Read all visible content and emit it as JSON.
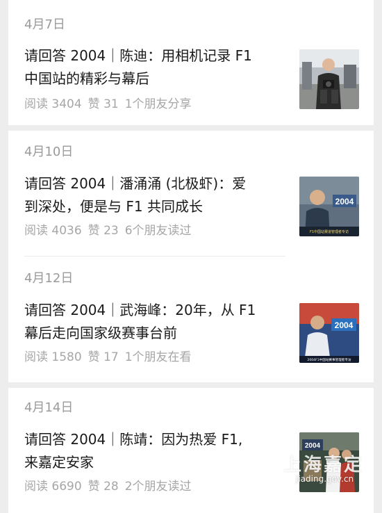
{
  "feed": {
    "articles": [
      {
        "date": "4月7日",
        "title_line1": "请回答 2004｜陈迪：用相机记录 F1",
        "title_line2": "中国站的精彩与幕后",
        "reads": "阅读 3404",
        "likes": "赞 31",
        "friends": "1个朋友分享"
      },
      {
        "date": "4月10日",
        "title_line1": "请回答 2004｜潘涌涌 (北极虾)：爱",
        "title_line2": "到深处，便是与 F1 共同成长",
        "reads": "阅读 4036",
        "likes": "赞 23",
        "friends": "6个朋友读过",
        "thumb_badge": "2004",
        "thumb_caption": "F1中国站赛道管理者专访"
      },
      {
        "date": "4月12日",
        "title_line1": "请回答 2004｜武海峰：20年，从 F1",
        "title_line2": "幕后走向国家级赛事台前",
        "reads": "阅读 1580",
        "likes": "赞 17",
        "friends": "1个朋友在看",
        "thumb_badge": "2004",
        "thumb_caption": "2004F1中国站赛事管理者专访"
      },
      {
        "date": "4月14日",
        "title_line1": "请回答 2004｜陈靖：因为热爱 F1,",
        "title_line2": "来嘉定安家",
        "reads": "阅读 6690",
        "likes": "赞 28",
        "friends": "2个朋友读过",
        "thumb_badge": "2004"
      }
    ]
  },
  "watermark": {
    "big": "上海嘉定",
    "small": "jiading.gov.cn"
  },
  "colors": {
    "background": "#ededed",
    "card": "#ffffff",
    "title": "#1a1a1a",
    "meta": "#a6a6a6",
    "date": "#9a9a9a"
  }
}
